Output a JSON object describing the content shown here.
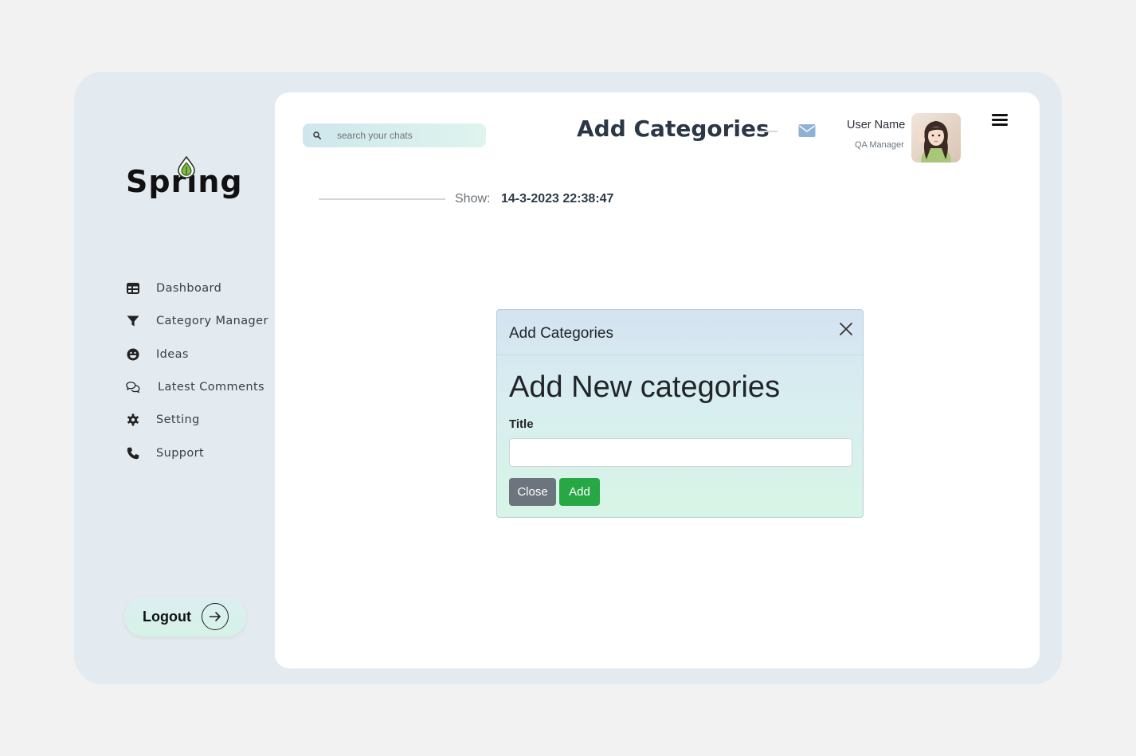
{
  "app": {
    "logo_text": "Spring"
  },
  "sidebar": {
    "items": [
      {
        "label": "Dashboard",
        "icon": "table-icon"
      },
      {
        "label": "Category Manager",
        "icon": "filter-icon"
      },
      {
        "label": "Ideas",
        "icon": "smile-icon"
      },
      {
        "label": "Latest Comments",
        "icon": "comments-icon"
      },
      {
        "label": "Setting",
        "icon": "gear-icon"
      },
      {
        "label": "Support",
        "icon": "phone-icon"
      }
    ],
    "logout_label": "Logout"
  },
  "header": {
    "search_placeholder": "search your chats",
    "title": "Add Categories",
    "user_name": "User Name",
    "user_role": "QA Manager"
  },
  "main": {
    "show_label": "Show:",
    "show_value": "14-3-2023 22:38:47"
  },
  "modal": {
    "title": "Add Categories",
    "heading": "Add New categories",
    "field_label": "Title",
    "field_value": "",
    "close_label": "Close",
    "add_label": "Add"
  },
  "colors": {
    "shell_bg": "#e3eaf0",
    "accent_green": "#28a745",
    "secondary_gray": "#6c757d",
    "mail_icon": "#8fb1d4"
  }
}
